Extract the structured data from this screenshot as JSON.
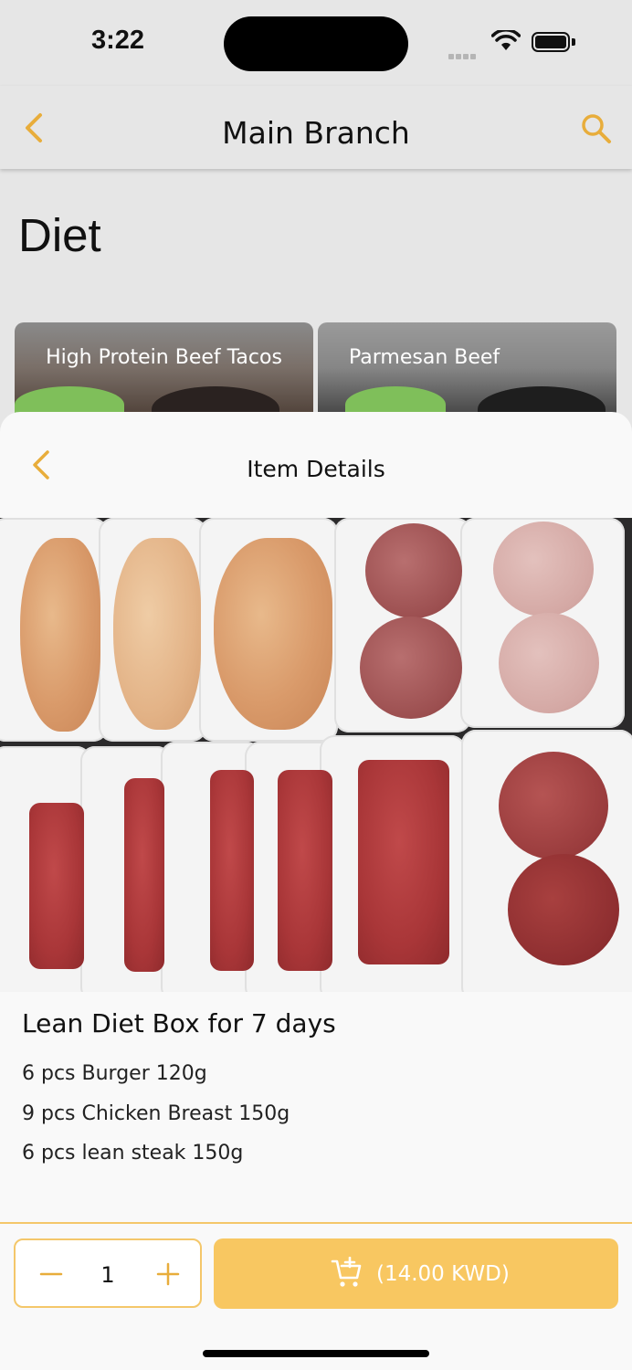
{
  "status_bar": {
    "time": "3:22"
  },
  "navbar": {
    "title": "Main Branch",
    "back_icon": "chevron-left-icon",
    "search_icon": "search-icon"
  },
  "category": {
    "title": "Diet",
    "items": [
      {
        "label": "High Protein Beef Tacos"
      },
      {
        "label": "Parmesan Beef"
      }
    ]
  },
  "item_details": {
    "header": "Item Details",
    "product_name": "Lean Diet Box for 7 days",
    "description": [
      "6 pcs Burger 120g",
      "9 pcs Chicken Breast 150g",
      "6 pcs lean steak 150g"
    ]
  },
  "cart": {
    "quantity": "1",
    "add_label": "(14.00 KWD)"
  },
  "colors": {
    "accent": "#f8c761",
    "accent_border": "#f4c76a",
    "icon": "#e8ad3b"
  }
}
